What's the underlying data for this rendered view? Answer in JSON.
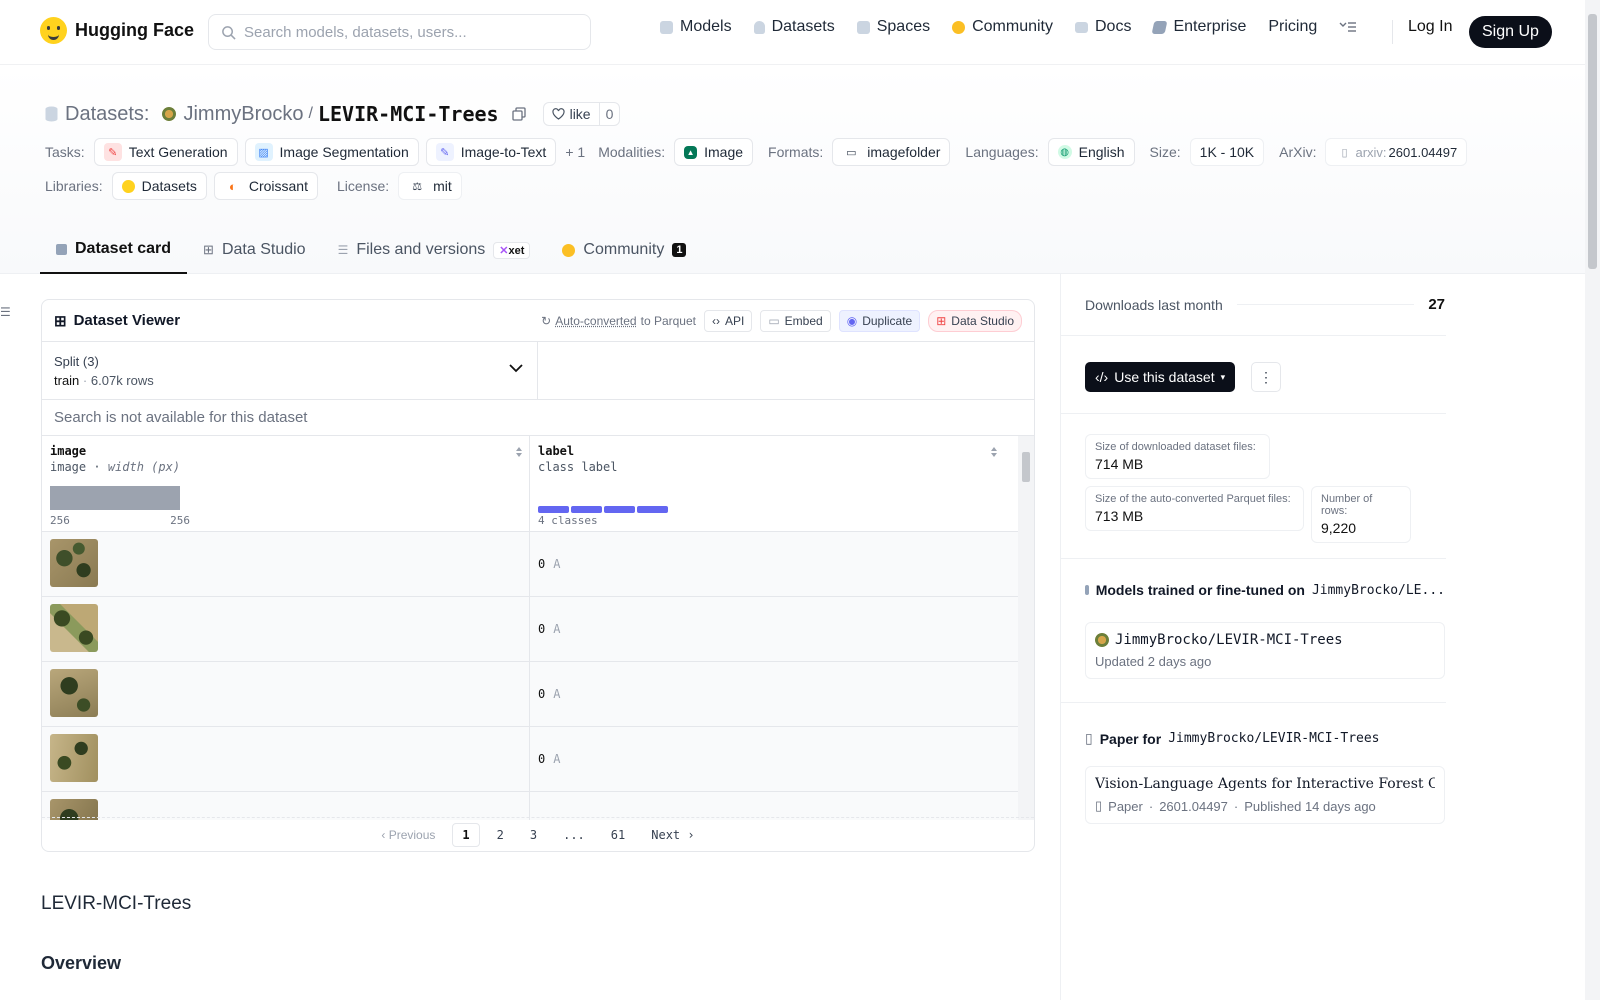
{
  "nav": {
    "brand": "Hugging Face",
    "search_placeholder": "Search models, datasets, users...",
    "links": [
      {
        "label": "Models",
        "icon": "cube-icon",
        "color": "#9ca3af"
      },
      {
        "label": "Datasets",
        "icon": "database-icon",
        "color": "#9ca3af"
      },
      {
        "label": "Spaces",
        "icon": "grid-icon",
        "color": "#9ca3af"
      },
      {
        "label": "Community",
        "icon": "face-icon",
        "color": "#fbbf24"
      },
      {
        "label": "Docs",
        "icon": "book-icon",
        "color": "#9ca3af"
      },
      {
        "label": "Enterprise",
        "icon": "enterprise-icon",
        "color": "#9ca3af"
      },
      {
        "label": "Pricing",
        "icon": "",
        "color": ""
      }
    ],
    "login": "Log In",
    "signup": "Sign Up"
  },
  "repo": {
    "type_label": "Datasets:",
    "owner": "JimmyBrocko",
    "separator": "/",
    "name": "LEVIR-MCI-Trees",
    "like_label": "like",
    "like_count": "0"
  },
  "tags": {
    "tasks_label": "Tasks:",
    "tasks": [
      "Text Generation",
      "Image Segmentation",
      "Image-to-Text"
    ],
    "tasks_more": "+ 1",
    "modalities_label": "Modalities:",
    "modalities": [
      "Image"
    ],
    "formats_label": "Formats:",
    "formats": [
      "imagefolder"
    ],
    "languages_label": "Languages:",
    "languages": [
      "English"
    ],
    "size_label": "Size:",
    "size": "1K - 10K",
    "arxiv_label": "ArXiv:",
    "arxiv_prefix": "arxiv:",
    "arxiv_id": "2601.04497",
    "libraries_label": "Libraries:",
    "libraries": [
      "Datasets",
      "Croissant"
    ],
    "license_label": "License:",
    "license": "mit"
  },
  "tabs": [
    {
      "label": "Dataset card",
      "active": true
    },
    {
      "label": "Data Studio",
      "active": false
    },
    {
      "label": "Files and versions",
      "badge": "xet",
      "active": false
    },
    {
      "label": "Community",
      "badge": "1",
      "active": false
    }
  ],
  "viewer": {
    "title": "Dataset Viewer",
    "autoconv_link": "Auto-converted",
    "autoconv_rest": " to Parquet",
    "btn_api": "API",
    "btn_embed": "Embed",
    "btn_duplicate": "Duplicate",
    "btn_datastudio": "Data Studio",
    "split_label": "Split (3)",
    "split_value": "train",
    "split_rows": "6.07k rows",
    "search_na": "Search is not available for this dataset",
    "columns": [
      {
        "name": "image",
        "type": "image",
        "subtype": "width (px)",
        "min": "256",
        "max": "256"
      },
      {
        "name": "label",
        "type": "class label",
        "classes": "4 classes"
      }
    ],
    "rows": [
      {
        "label": "0",
        "label_name": "A"
      },
      {
        "label": "0",
        "label_name": "A"
      },
      {
        "label": "0",
        "label_name": "A"
      },
      {
        "label": "0",
        "label_name": "A"
      }
    ],
    "pager": {
      "prev": "Previous",
      "pages": [
        "1",
        "2",
        "3",
        "...",
        "61"
      ],
      "next": "Next"
    }
  },
  "content": {
    "h1": "LEVIR-MCI-Trees",
    "h2": "Overview"
  },
  "sidebar": {
    "downloads_label": "Downloads last month",
    "downloads_value": "27",
    "use_button": "Use this dataset",
    "size_dl_label": "Size of downloaded dataset files:",
    "size_dl_value": "714 MB",
    "size_parquet_label": "Size of the auto-converted Parquet files:",
    "size_parquet_value": "713 MB",
    "rows_label": "Number of rows:",
    "rows_value": "9,220",
    "models_heading": "Models trained or fine-tuned on",
    "models_heading_repo": "JimmyBrocko/LE...",
    "model_name": "JimmyBrocko/LEVIR-MCI-Trees",
    "model_updated": "Updated 2 days ago",
    "paper_heading": "Paper for",
    "paper_heading_repo": "JimmyBrocko/LEVIR-MCI-Trees",
    "paper_title": "Vision-Language Agents for Interactive Forest Cha...",
    "paper_kind": "Paper",
    "paper_id": "2601.04497",
    "paper_published": "Published 14 days ago"
  }
}
